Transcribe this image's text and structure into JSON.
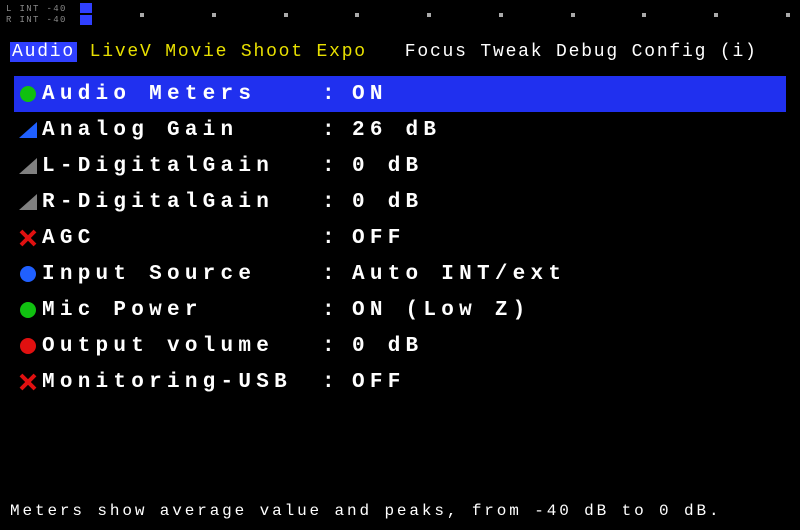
{
  "meters": {
    "left_label": "L INT -40",
    "right_label": "R INT -40"
  },
  "tabs": {
    "active": "Audio",
    "yellow": [
      "LiveV",
      "Movie",
      "Shoot",
      "Expo"
    ],
    "white": [
      "Focus",
      "Tweak",
      "Debug",
      "Config",
      "(i)"
    ]
  },
  "menu": [
    {
      "icon": "dot-green",
      "label": "Audio Meters",
      "value": "ON",
      "selected": true
    },
    {
      "icon": "tri-blue",
      "label": "Analog Gain",
      "value": "26 dB",
      "selected": false
    },
    {
      "icon": "tri-gray",
      "label": "L-DigitalGain",
      "value": "0 dB",
      "selected": false
    },
    {
      "icon": "tri-gray",
      "label": "R-DigitalGain",
      "value": "0 dB",
      "selected": false
    },
    {
      "icon": "x-red",
      "label": "AGC",
      "value": "OFF",
      "selected": false
    },
    {
      "icon": "dot-blue",
      "label": "Input Source",
      "value": "Auto INT/ext",
      "selected": false
    },
    {
      "icon": "dot-green",
      "label": "Mic Power",
      "value": "ON (Low Z)",
      "selected": false
    },
    {
      "icon": "dot-red",
      "label": "Output volume",
      "value": "0 dB",
      "selected": false
    },
    {
      "icon": "x-red",
      "label": "Monitoring-USB",
      "value": "OFF",
      "selected": false
    }
  ],
  "help_text": "Meters show average value and peaks, from -40 dB to 0 dB.",
  "colors": {
    "accent_blue": "#2030ef",
    "green": "#10c010",
    "red": "#e01010",
    "blue": "#2060ff",
    "gray": "#808080",
    "yellow": "#e8e000"
  }
}
